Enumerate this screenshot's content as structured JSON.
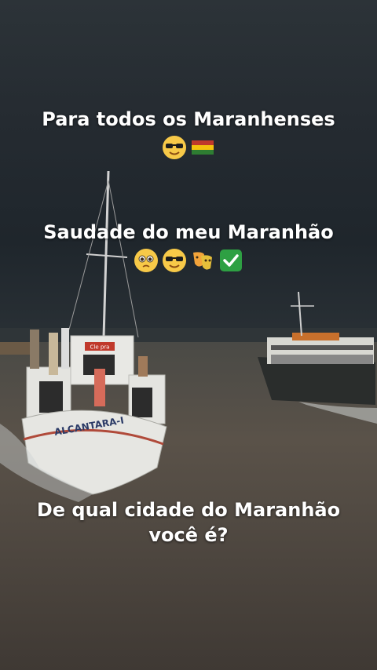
{
  "captions": {
    "line1": "Para todos os Maranhenses",
    "line2": "Saudade do meu Maranhão",
    "line3a": "De qual cidade do Maranhão",
    "line3b": "você é?"
  },
  "emoji_rows": {
    "row1": [
      "sunglasses-emoji",
      "maranhao-flag-emoji"
    ],
    "row2": [
      "pleading-face-emoji",
      "sunglasses-emoji",
      "performing-arts-emoji",
      "check-mark-emoji"
    ]
  },
  "boats": {
    "left_hull_text": "ALCANTARA-I",
    "left_cabin_sign": "Cle pra"
  },
  "colors": {
    "sky": "#252b31",
    "water": "#524a42",
    "hull": "#e6e6e6",
    "flag_yellow": "#f4c20d",
    "flag_red": "#d62828",
    "check_green": "#2ea043"
  }
}
